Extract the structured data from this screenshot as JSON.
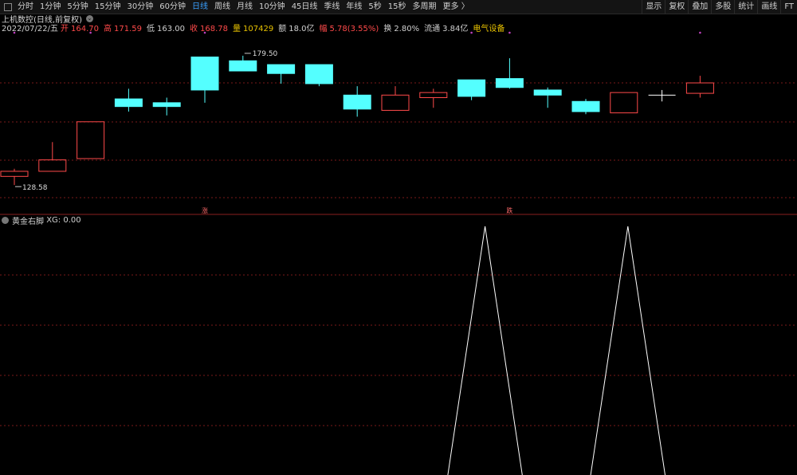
{
  "toolbar": {
    "periods": [
      "分时",
      "1分钟",
      "5分钟",
      "15分钟",
      "30分钟",
      "60分钟",
      "日线",
      "周线",
      "月线",
      "10分钟",
      "45日线",
      "季线",
      "年线",
      "5秒",
      "15秒",
      "多周期",
      "更多 〉"
    ],
    "active_index": 6,
    "right_buttons": [
      "显示",
      "复权",
      "叠加",
      "多股",
      "统计",
      "画线",
      "FT"
    ]
  },
  "title": "上机数控(日线,前复权)",
  "info": {
    "date": "2022/07/22/五",
    "open_label": "开",
    "open": "164.70",
    "high_label": "高",
    "high": "171.59",
    "low_label": "低",
    "low": "163.00",
    "close_label": "收",
    "close": "168.78",
    "vol_label": "量",
    "vol": "107429",
    "amt_label": "额",
    "amt": "18.0亿",
    "amp_label": "幅",
    "amp": "5.78(3.55%)",
    "turn_label": "换",
    "turn": "2.80%",
    "float_label": "流通",
    "float": "3.84亿",
    "sector": "电气设备"
  },
  "indicator": {
    "name": "黄金右脚",
    "series_label": "XG:",
    "value": "0.00"
  },
  "colors": {
    "up": "#ff4a4a",
    "down": "#54ffff",
    "doji": "#ffffff",
    "grid": "#7a1a1a",
    "marker": "#c040c0"
  },
  "chart_data": [
    {
      "type": "candlestick",
      "title": "上机数控(日线,前复权)",
      "ylim": [
        123,
        187
      ],
      "annotations": [
        {
          "text": "179.50",
          "kind": "high"
        },
        {
          "text": "128.58",
          "kind": "low"
        },
        {
          "text": "涨",
          "index": 5
        },
        {
          "text": "跌",
          "index": 13
        }
      ],
      "markers_top": [
        0,
        2,
        5,
        12,
        13,
        18
      ],
      "candles": [
        {
          "o": 132.0,
          "c": 134.0,
          "h": 135.0,
          "l": 128.6
        },
        {
          "o": 134.0,
          "c": 138.5,
          "h": 145.5,
          "l": 134.0
        },
        {
          "o": 139.0,
          "c": 153.5,
          "h": 153.5,
          "l": 139.0
        },
        {
          "o": 162.5,
          "c": 159.5,
          "h": 166.5,
          "l": 157.5
        },
        {
          "o": 161.0,
          "c": 159.5,
          "h": 163.0,
          "l": 156.0
        },
        {
          "o": 179.0,
          "c": 166.0,
          "h": 179.0,
          "l": 161.0
        },
        {
          "o": 177.5,
          "c": 173.5,
          "h": 179.5,
          "l": 173.5
        },
        {
          "o": 176.0,
          "c": 172.5,
          "h": 176.0,
          "l": 168.5
        },
        {
          "o": 176.0,
          "c": 168.5,
          "h": 176.0,
          "l": 167.5
        },
        {
          "o": 164.0,
          "c": 158.5,
          "h": 167.5,
          "l": 155.5
        },
        {
          "o": 158.0,
          "c": 164.0,
          "h": 167.5,
          "l": 158.0
        },
        {
          "o": 163.0,
          "c": 165.0,
          "h": 166.5,
          "l": 159.0
        },
        {
          "o": 170.0,
          "c": 163.5,
          "h": 170.0,
          "l": 162.0
        },
        {
          "o": 170.5,
          "c": 167.0,
          "h": 178.5,
          "l": 166.5
        },
        {
          "o": 166.0,
          "c": 164.0,
          "h": 167.0,
          "l": 159.0
        },
        {
          "o": 161.5,
          "c": 157.5,
          "h": 162.5,
          "l": 156.5
        },
        {
          "o": 157.0,
          "c": 165.0,
          "h": 165.0,
          "l": 157.0
        },
        {
          "o": 164.0,
          "c": 164.0,
          "h": 166.0,
          "l": 161.5
        },
        {
          "o": 164.7,
          "c": 168.8,
          "h": 171.6,
          "l": 163.0
        }
      ]
    },
    {
      "type": "line",
      "series": [
        {
          "values": [
            0,
            0,
            0,
            0,
            0,
            0,
            0,
            0,
            0,
            0,
            0,
            0,
            1,
            0,
            0,
            0,
            1,
            0,
            0
          ]
        }
      ]
    }
  ]
}
